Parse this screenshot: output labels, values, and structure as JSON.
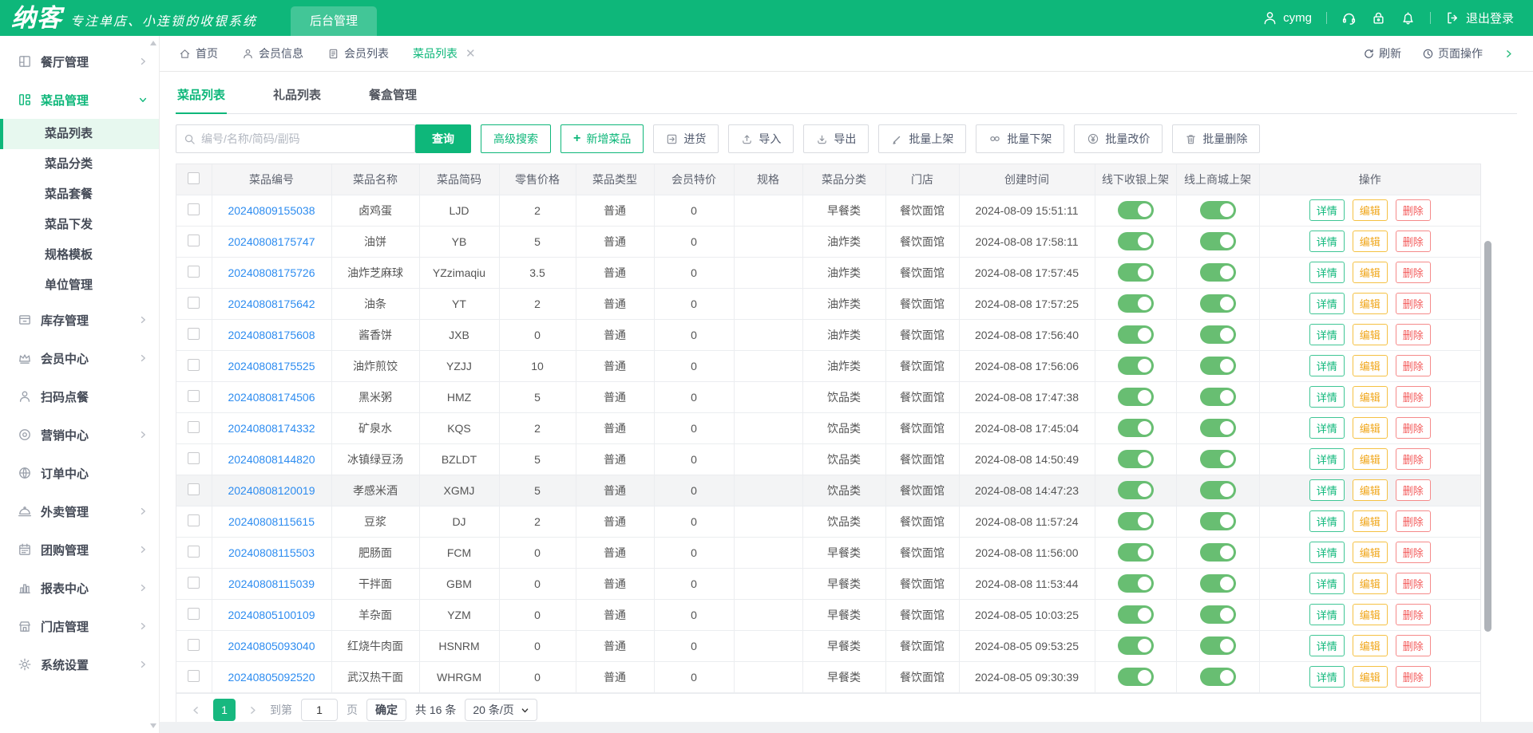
{
  "topbar": {
    "logo": "纳客",
    "tagline": "专注单店、小连锁的收银系统",
    "admin_tab": "后台管理",
    "username": "cymg",
    "logout_label": "退出登录"
  },
  "tabbar": {
    "tabs": [
      {
        "label": "首页",
        "icon": "home"
      },
      {
        "label": "会员信息",
        "icon": "user"
      },
      {
        "label": "会员列表",
        "icon": "document"
      },
      {
        "label": "菜品列表",
        "icon": "none",
        "active": true,
        "closable": true
      }
    ],
    "refresh_label": "刷新",
    "page_ops_label": "页面操作"
  },
  "sidebar": {
    "items": [
      {
        "label": "餐厅管理",
        "icon": "restaurant",
        "expandable": true
      },
      {
        "label": "菜品管理",
        "icon": "dishes",
        "expandable": true,
        "active": true,
        "expanded": true,
        "children": [
          "菜品列表",
          "菜品分类",
          "菜品套餐",
          "菜品下发",
          "规格模板",
          "单位管理"
        ],
        "active_child": "菜品列表"
      },
      {
        "label": "库存管理",
        "icon": "inventory",
        "expandable": true
      },
      {
        "label": "会员中心",
        "icon": "crown",
        "expandable": true
      },
      {
        "label": "扫码点餐",
        "icon": "person",
        "expandable": false
      },
      {
        "label": "营销中心",
        "icon": "target",
        "expandable": true
      },
      {
        "label": "订单中心",
        "icon": "globe",
        "expandable": false
      },
      {
        "label": "外卖管理",
        "icon": "cloche",
        "expandable": true
      },
      {
        "label": "团购管理",
        "icon": "calendar",
        "expandable": true
      },
      {
        "label": "报表中心",
        "icon": "bar-chart",
        "expandable": true
      },
      {
        "label": "门店管理",
        "icon": "shop",
        "expandable": true
      },
      {
        "label": "系统设置",
        "icon": "gear",
        "expandable": true
      }
    ]
  },
  "content": {
    "page_tabs": [
      {
        "label": "菜品列表",
        "active": true
      },
      {
        "label": "礼品列表"
      },
      {
        "label": "餐盒管理"
      }
    ],
    "toolbar": {
      "search_placeholder": "编号/名称/简码/副码",
      "query": "查询",
      "advanced_search": "高级搜索",
      "add_dish": "新增菜品",
      "purchase": "进货",
      "import": "导入",
      "export": "导出",
      "batch_on": "批量上架",
      "batch_off": "批量下架",
      "batch_price": "批量改价",
      "batch_delete": "批量删除"
    },
    "table": {
      "columns": [
        "菜品编号",
        "菜品名称",
        "菜品简码",
        "零售价格",
        "菜品类型",
        "会员特价",
        "规格",
        "菜品分类",
        "门店",
        "创建时间",
        "线下收银上架",
        "线上商城上架",
        "操作"
      ],
      "action_labels": [
        "详情",
        "编辑",
        "删除"
      ],
      "rows": [
        {
          "id": "20240809155038",
          "name": "卤鸡蛋",
          "code": "LJD",
          "price": "2",
          "type": "普通",
          "vip": "0",
          "spec": "",
          "cat": "早餐类",
          "store": "餐饮面馆",
          "time": "2024-08-09 15:51:11",
          "pos_on": true,
          "mall_on": true
        },
        {
          "id": "20240808175747",
          "name": "油饼",
          "code": "YB",
          "price": "5",
          "type": "普通",
          "vip": "0",
          "spec": "",
          "cat": "油炸类",
          "store": "餐饮面馆",
          "time": "2024-08-08 17:58:11",
          "pos_on": true,
          "mall_on": true
        },
        {
          "id": "20240808175726",
          "name": "油炸芝麻球",
          "code": "YZzimaqiu",
          "price": "3.5",
          "type": "普通",
          "vip": "0",
          "spec": "",
          "cat": "油炸类",
          "store": "餐饮面馆",
          "time": "2024-08-08 17:57:45",
          "pos_on": true,
          "mall_on": true
        },
        {
          "id": "20240808175642",
          "name": "油条",
          "code": "YT",
          "price": "2",
          "type": "普通",
          "vip": "0",
          "spec": "",
          "cat": "油炸类",
          "store": "餐饮面馆",
          "time": "2024-08-08 17:57:25",
          "pos_on": true,
          "mall_on": true
        },
        {
          "id": "20240808175608",
          "name": "酱香饼",
          "code": "JXB",
          "price": "0",
          "type": "普通",
          "vip": "0",
          "spec": "",
          "cat": "油炸类",
          "store": "餐饮面馆",
          "time": "2024-08-08 17:56:40",
          "pos_on": true,
          "mall_on": true
        },
        {
          "id": "20240808175525",
          "name": "油炸煎饺",
          "code": "YZJJ",
          "price": "10",
          "type": "普通",
          "vip": "0",
          "spec": "",
          "cat": "油炸类",
          "store": "餐饮面馆",
          "time": "2024-08-08 17:56:06",
          "pos_on": true,
          "mall_on": true
        },
        {
          "id": "20240808174506",
          "name": "黑米粥",
          "code": "HMZ",
          "price": "5",
          "type": "普通",
          "vip": "0",
          "spec": "",
          "cat": "饮品类",
          "store": "餐饮面馆",
          "time": "2024-08-08 17:47:38",
          "pos_on": true,
          "mall_on": true
        },
        {
          "id": "20240808174332",
          "name": "矿泉水",
          "code": "KQS",
          "price": "2",
          "type": "普通",
          "vip": "0",
          "spec": "",
          "cat": "饮品类",
          "store": "餐饮面馆",
          "time": "2024-08-08 17:45:04",
          "pos_on": true,
          "mall_on": true
        },
        {
          "id": "20240808144820",
          "name": "冰镇绿豆汤",
          "code": "BZLDT",
          "price": "5",
          "type": "普通",
          "vip": "0",
          "spec": "",
          "cat": "饮品类",
          "store": "餐饮面馆",
          "time": "2024-08-08 14:50:49",
          "pos_on": true,
          "mall_on": true
        },
        {
          "id": "20240808120019",
          "name": "孝感米酒",
          "code": "XGMJ",
          "price": "5",
          "type": "普通",
          "vip": "0",
          "spec": "",
          "cat": "饮品类",
          "store": "餐饮面馆",
          "time": "2024-08-08 14:47:23",
          "pos_on": true,
          "mall_on": true,
          "highlight": true
        },
        {
          "id": "20240808115615",
          "name": "豆浆",
          "code": "DJ",
          "price": "2",
          "type": "普通",
          "vip": "0",
          "spec": "",
          "cat": "饮品类",
          "store": "餐饮面馆",
          "time": "2024-08-08 11:57:24",
          "pos_on": true,
          "mall_on": true
        },
        {
          "id": "20240808115503",
          "name": "肥肠面",
          "code": "FCM",
          "price": "0",
          "type": "普通",
          "vip": "0",
          "spec": "",
          "cat": "早餐类",
          "store": "餐饮面馆",
          "time": "2024-08-08 11:56:00",
          "pos_on": true,
          "mall_on": true
        },
        {
          "id": "20240808115039",
          "name": "干拌面",
          "code": "GBM",
          "price": "0",
          "type": "普通",
          "vip": "0",
          "spec": "",
          "cat": "早餐类",
          "store": "餐饮面馆",
          "time": "2024-08-08 11:53:44",
          "pos_on": true,
          "mall_on": true
        },
        {
          "id": "20240805100109",
          "name": "羊杂面",
          "code": "YZM",
          "price": "0",
          "type": "普通",
          "vip": "0",
          "spec": "",
          "cat": "早餐类",
          "store": "餐饮面馆",
          "time": "2024-08-05 10:03:25",
          "pos_on": true,
          "mall_on": true
        },
        {
          "id": "20240805093040",
          "name": "红烧牛肉面",
          "code": "HSNRM",
          "price": "0",
          "type": "普通",
          "vip": "0",
          "spec": "",
          "cat": "早餐类",
          "store": "餐饮面馆",
          "time": "2024-08-05 09:53:25",
          "pos_on": true,
          "mall_on": true
        },
        {
          "id": "20240805092520",
          "name": "武汉热干面",
          "code": "WHRGM",
          "price": "0",
          "type": "普通",
          "vip": "0",
          "spec": "",
          "cat": "早餐类",
          "store": "餐饮面馆",
          "time": "2024-08-05 09:30:39",
          "pos_on": true,
          "mall_on": true
        }
      ]
    },
    "pagination": {
      "current_page": "1",
      "goto_prefix": "到第",
      "goto_value": "1",
      "goto_suffix": "页",
      "confirm": "确定",
      "total": "共 16 条",
      "page_size": "20 条/页"
    }
  },
  "colors": {
    "accent_green": "#0eb77a",
    "toggle_green": "#68be72",
    "link_blue": "#2d8cf0",
    "edit_yellow": "#f0a71c",
    "delete_red": "#f35a5a"
  }
}
